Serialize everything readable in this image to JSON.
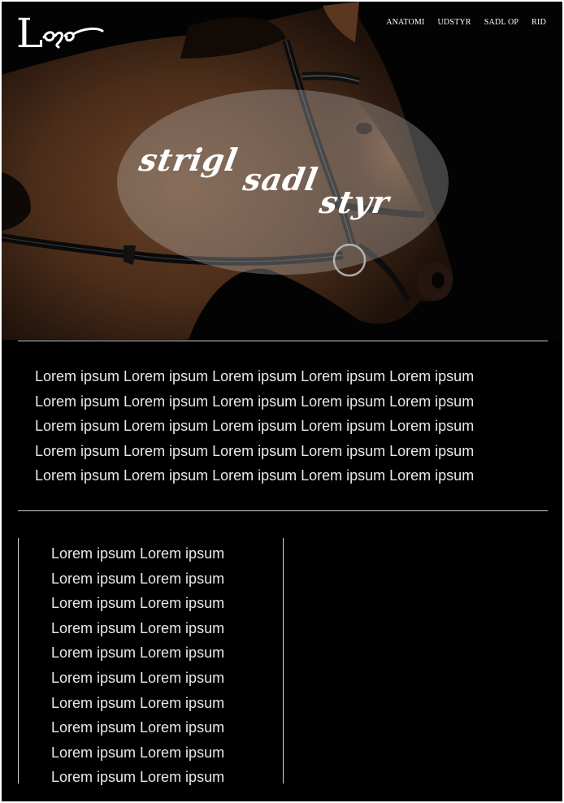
{
  "logo": {
    "text": "Logo"
  },
  "nav": {
    "items": [
      {
        "label": "ANATOMI"
      },
      {
        "label": "UDSTYR"
      },
      {
        "label": "SADL OP"
      },
      {
        "label": "RID"
      }
    ]
  },
  "hero": {
    "slogan": [
      "strigl",
      "sadl",
      "styr"
    ],
    "overlay_color": "#c8c8c8"
  },
  "intro": {
    "lines": [
      "Lorem ipsum Lorem ipsum Lorem ipsum Lorem ipsum Lorem ipsum",
      "Lorem ipsum Lorem ipsum Lorem ipsum Lorem ipsum Lorem ipsum",
      "Lorem ipsum Lorem ipsum Lorem ipsum Lorem ipsum Lorem ipsum",
      "Lorem ipsum Lorem ipsum Lorem ipsum Lorem ipsum Lorem ipsum",
      "Lorem ipsum Lorem ipsum Lorem ipsum Lorem ipsum Lorem ipsum"
    ]
  },
  "list": {
    "items": [
      "Lorem ipsum Lorem ipsum",
      "Lorem ipsum Lorem ipsum",
      "Lorem ipsum Lorem ipsum",
      "Lorem ipsum Lorem ipsum",
      "Lorem ipsum Lorem ipsum",
      "Lorem ipsum Lorem ipsum",
      "Lorem ipsum Lorem ipsum",
      "Lorem ipsum Lorem ipsum",
      "Lorem ipsum Lorem ipsum",
      "Lorem ipsum Lorem ipsum"
    ]
  },
  "colors": {
    "background": "#000000",
    "text": "#e9e9e9",
    "rule": "#cfcfcf"
  }
}
